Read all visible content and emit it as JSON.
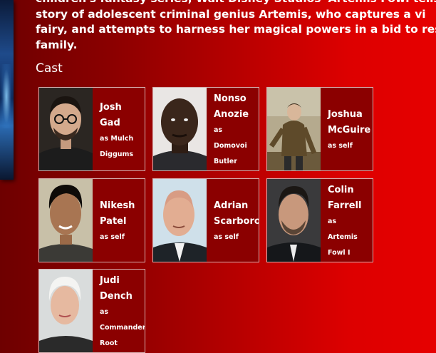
{
  "synopsis_lines": [
    "children's fantasy series, Walt Disney Studios' Artemis Fowl tells",
    "story of adolescent criminal genius Artemis, who captures a vi",
    "fairy, and attempts to harness her magical powers in a bid to rescu",
    "family."
  ],
  "cast_heading": "Cast",
  "cast": [
    {
      "name_lines": [
        "Josh",
        "Gad"
      ],
      "role_lines": [
        "as Mulch",
        "Diggums"
      ]
    },
    {
      "name_lines": [
        "Nonso",
        "Anozie"
      ],
      "role_lines": [
        "as",
        "Domovoi",
        "Butler"
      ]
    },
    {
      "name_lines": [
        "Joshua",
        "McGuire"
      ],
      "role_lines": [
        "as self"
      ]
    },
    {
      "name_lines": [
        "Nikesh",
        "Patel"
      ],
      "role_lines": [
        "as self"
      ]
    },
    {
      "name_lines": [
        "Adrian",
        "Scarborou"
      ],
      "role_lines": [
        "as self"
      ]
    },
    {
      "name_lines": [
        "Colin",
        "Farrell"
      ],
      "role_lines": [
        "as",
        "Artemis",
        "Fowl I"
      ]
    },
    {
      "name_lines": [
        "Judi",
        "Dench"
      ],
      "role_lines": [
        "as",
        "Commander",
        "Root"
      ]
    }
  ]
}
